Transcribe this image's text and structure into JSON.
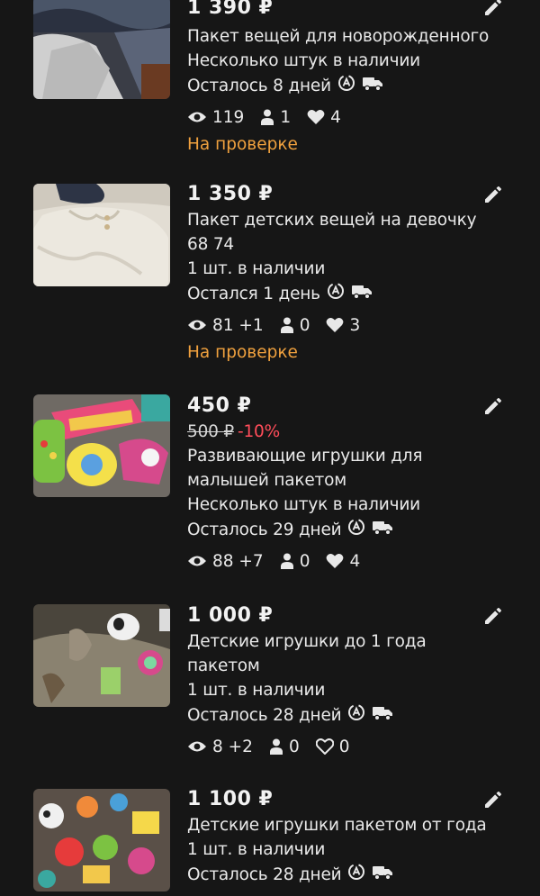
{
  "listings": [
    {
      "price": "1 390 ₽",
      "title_lines": [
        "Пакет вещей для новорожденного"
      ],
      "stock": "Несколько штук в наличии",
      "time_left": "Осталось 8 дней",
      "views": "119",
      "contacts": "1",
      "favorites": "4",
      "status": "На проверке",
      "thumb_icon": "baby-clothes-photo"
    },
    {
      "price": "1 350 ₽",
      "title_lines": [
        "Пакет детских вещей на девочку",
        "68 74"
      ],
      "stock": "1 шт. в наличии",
      "time_left": "Остался 1 день",
      "views": "81 +1",
      "contacts": "0",
      "favorites": "3",
      "status": "На проверке",
      "thumb_icon": "girl-clothes-photo"
    },
    {
      "price": "450 ₽",
      "old_price": "500 ₽",
      "discount": "-10%",
      "title_lines": [
        "Развивающие игрушки для",
        "малышей пакетом"
      ],
      "stock": "Несколько штук в наличии",
      "time_left": "Осталось 29 дней",
      "views": "88 +7",
      "contacts": "0",
      "favorites": "4",
      "thumb_icon": "educational-toys-photo"
    },
    {
      "price": "1 000 ₽",
      "title_lines": [
        "Детские игрушки до 1 года",
        "пакетом"
      ],
      "stock": "1 шт. в наличии",
      "time_left": "Осталось 28 дней",
      "views": "8 +2",
      "contacts": "0",
      "favorites": "0",
      "thumb_icon": "baby-toys-photo"
    },
    {
      "price": "1 100 ₽",
      "title_lines": [
        "Детские игрушки пакетом от года"
      ],
      "stock": "1 шт. в наличии",
      "time_left": "Осталось 28 дней",
      "thumb_icon": "toddler-toys-photo"
    }
  ],
  "colors": {
    "background": "#161616",
    "text": "#e9e9e9",
    "status_review": "#f0a13e",
    "discount": "#ff4d5a"
  },
  "icons": [
    "edit-icon",
    "eye-icon",
    "person-icon",
    "heart-icon",
    "autopromo-icon",
    "delivery-truck-icon"
  ]
}
